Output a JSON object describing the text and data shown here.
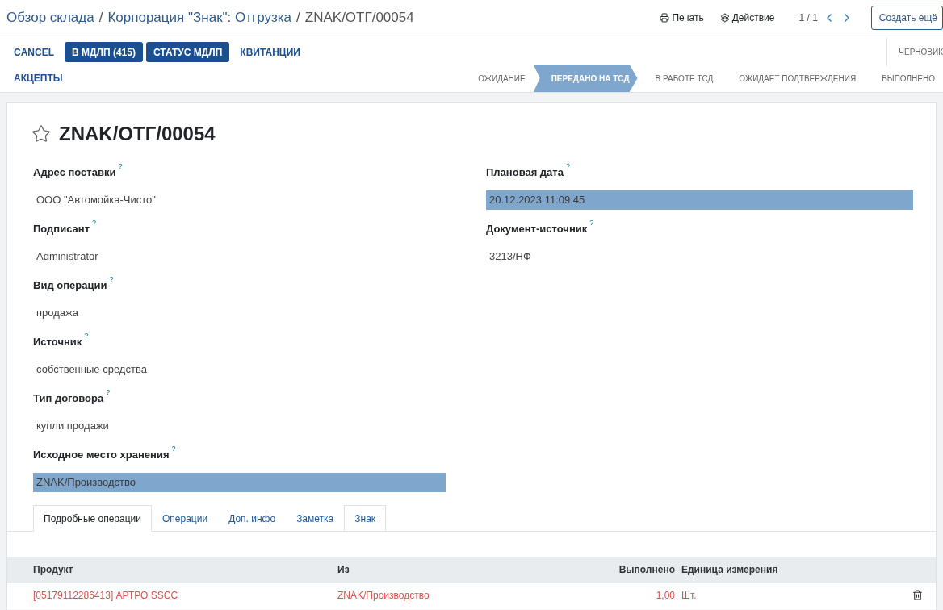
{
  "breadcrumb": [
    "Обзор склада",
    "Корпорация \"Знак\": Отгрузка",
    "ZNAK/ОТГ/00054"
  ],
  "breadcrumb_separator": "/",
  "header_actions": [
    {
      "kind": "print",
      "label": "Печать"
    },
    {
      "kind": "gear",
      "label": "Действие"
    }
  ],
  "pager": "1 / 1",
  "create_button": "Создать ещё",
  "action_buttons": [
    {
      "kind": "link",
      "label": "CANCEL"
    },
    {
      "kind": "primary",
      "label": "В МДЛП (415)"
    },
    {
      "kind": "primary",
      "label": "СТАТУС МДЛП"
    },
    {
      "kind": "link",
      "label": "КВИТАНЦИИ"
    },
    {
      "kind": "link",
      "label": "АКЦЕПТЫ"
    }
  ],
  "status_steps": [
    {
      "label": "ЧЕРНОВИК",
      "selected": false
    },
    {
      "label": "ОЖИДАНИЕ",
      "selected": false
    },
    {
      "label": "ПЕРЕДАНО НА ТСД",
      "selected": true
    },
    {
      "label": "В РАБОТЕ ТСД",
      "selected": false
    },
    {
      "label": "ОЖИДАЕТ ПОДТВЕРЖДЕНИЯ",
      "selected": false
    },
    {
      "label": "ВЫПОЛНЕНО",
      "selected": false
    }
  ],
  "record": {
    "title": "ZNAK/ОТГ/00054",
    "favorite": false
  },
  "left_fields": [
    {
      "label": "Адрес поставки",
      "help": "?",
      "value": "ООО \"Автомойка-Чисто\"",
      "highlighted": false
    },
    {
      "label": "Подписант",
      "help": "?",
      "value": "Administrator",
      "highlighted": false
    },
    {
      "label": "Вид операции",
      "help": "?",
      "value": "продажа",
      "highlighted": false
    },
    {
      "label": "Источник",
      "help": "?",
      "value": "собственные средства",
      "highlighted": false
    },
    {
      "label": "Тип договора",
      "help": "?",
      "value": "купли продажи",
      "highlighted": false
    },
    {
      "label": "Исходное место хранения",
      "help": "?",
      "value": "ZNAK/Производство",
      "highlighted": true
    }
  ],
  "right_fields": [
    {
      "label": "Плановая дата",
      "help": "?",
      "value": "20.12.2023 11:09:45",
      "highlighted": true
    },
    {
      "label": "Документ-источник",
      "help": "?",
      "value": "3213/НФ",
      "highlighted": false
    }
  ],
  "tabs": [
    {
      "label": "Подробные операции",
      "selected": true,
      "hovered": false
    },
    {
      "label": "Операции",
      "selected": false,
      "hovered": false
    },
    {
      "label": "Доп. инфо",
      "selected": false,
      "hovered": false
    },
    {
      "label": "Заметка",
      "selected": false,
      "hovered": false
    },
    {
      "label": "Знак",
      "selected": false,
      "hovered": true
    }
  ],
  "table": {
    "columns": [
      "Продукт",
      "Из",
      "Выполнено",
      "Единица измерения"
    ],
    "rows": [
      {
        "product": "[05179112286413] АРТРО SSCC",
        "from": "ZNAK/Производство",
        "done": "1,00",
        "uom": "Шт."
      }
    ]
  }
}
